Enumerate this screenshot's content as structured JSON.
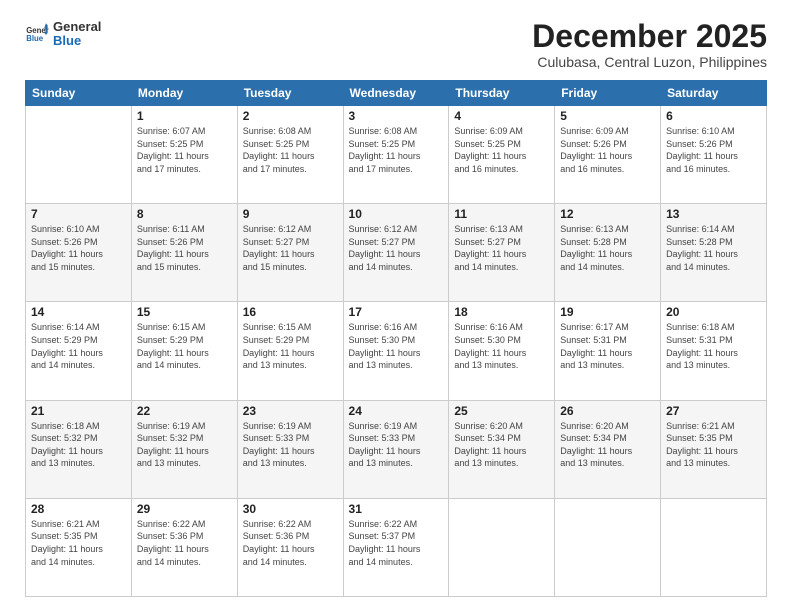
{
  "header": {
    "logo_general": "General",
    "logo_blue": "Blue",
    "month_title": "December 2025",
    "location": "Culubasa, Central Luzon, Philippines"
  },
  "days_of_week": [
    "Sunday",
    "Monday",
    "Tuesday",
    "Wednesday",
    "Thursday",
    "Friday",
    "Saturday"
  ],
  "weeks": [
    [
      {
        "day": "",
        "sunrise": "",
        "sunset": "",
        "daylight": ""
      },
      {
        "day": "1",
        "sunrise": "6:07 AM",
        "sunset": "5:25 PM",
        "daylight": "11 hours and 17 minutes."
      },
      {
        "day": "2",
        "sunrise": "6:08 AM",
        "sunset": "5:25 PM",
        "daylight": "11 hours and 17 minutes."
      },
      {
        "day": "3",
        "sunrise": "6:08 AM",
        "sunset": "5:25 PM",
        "daylight": "11 hours and 17 minutes."
      },
      {
        "day": "4",
        "sunrise": "6:09 AM",
        "sunset": "5:25 PM",
        "daylight": "11 hours and 16 minutes."
      },
      {
        "day": "5",
        "sunrise": "6:09 AM",
        "sunset": "5:26 PM",
        "daylight": "11 hours and 16 minutes."
      },
      {
        "day": "6",
        "sunrise": "6:10 AM",
        "sunset": "5:26 PM",
        "daylight": "11 hours and 16 minutes."
      }
    ],
    [
      {
        "day": "7",
        "sunrise": "6:10 AM",
        "sunset": "5:26 PM",
        "daylight": "11 hours and 15 minutes."
      },
      {
        "day": "8",
        "sunrise": "6:11 AM",
        "sunset": "5:26 PM",
        "daylight": "11 hours and 15 minutes."
      },
      {
        "day": "9",
        "sunrise": "6:12 AM",
        "sunset": "5:27 PM",
        "daylight": "11 hours and 15 minutes."
      },
      {
        "day": "10",
        "sunrise": "6:12 AM",
        "sunset": "5:27 PM",
        "daylight": "11 hours and 14 minutes."
      },
      {
        "day": "11",
        "sunrise": "6:13 AM",
        "sunset": "5:27 PM",
        "daylight": "11 hours and 14 minutes."
      },
      {
        "day": "12",
        "sunrise": "6:13 AM",
        "sunset": "5:28 PM",
        "daylight": "11 hours and 14 minutes."
      },
      {
        "day": "13",
        "sunrise": "6:14 AM",
        "sunset": "5:28 PM",
        "daylight": "11 hours and 14 minutes."
      }
    ],
    [
      {
        "day": "14",
        "sunrise": "6:14 AM",
        "sunset": "5:29 PM",
        "daylight": "11 hours and 14 minutes."
      },
      {
        "day": "15",
        "sunrise": "6:15 AM",
        "sunset": "5:29 PM",
        "daylight": "11 hours and 14 minutes."
      },
      {
        "day": "16",
        "sunrise": "6:15 AM",
        "sunset": "5:29 PM",
        "daylight": "11 hours and 13 minutes."
      },
      {
        "day": "17",
        "sunrise": "6:16 AM",
        "sunset": "5:30 PM",
        "daylight": "11 hours and 13 minutes."
      },
      {
        "day": "18",
        "sunrise": "6:16 AM",
        "sunset": "5:30 PM",
        "daylight": "11 hours and 13 minutes."
      },
      {
        "day": "19",
        "sunrise": "6:17 AM",
        "sunset": "5:31 PM",
        "daylight": "11 hours and 13 minutes."
      },
      {
        "day": "20",
        "sunrise": "6:18 AM",
        "sunset": "5:31 PM",
        "daylight": "11 hours and 13 minutes."
      }
    ],
    [
      {
        "day": "21",
        "sunrise": "6:18 AM",
        "sunset": "5:32 PM",
        "daylight": "11 hours and 13 minutes."
      },
      {
        "day": "22",
        "sunrise": "6:19 AM",
        "sunset": "5:32 PM",
        "daylight": "11 hours and 13 minutes."
      },
      {
        "day": "23",
        "sunrise": "6:19 AM",
        "sunset": "5:33 PM",
        "daylight": "11 hours and 13 minutes."
      },
      {
        "day": "24",
        "sunrise": "6:19 AM",
        "sunset": "5:33 PM",
        "daylight": "11 hours and 13 minutes."
      },
      {
        "day": "25",
        "sunrise": "6:20 AM",
        "sunset": "5:34 PM",
        "daylight": "11 hours and 13 minutes."
      },
      {
        "day": "26",
        "sunrise": "6:20 AM",
        "sunset": "5:34 PM",
        "daylight": "11 hours and 13 minutes."
      },
      {
        "day": "27",
        "sunrise": "6:21 AM",
        "sunset": "5:35 PM",
        "daylight": "11 hours and 13 minutes."
      }
    ],
    [
      {
        "day": "28",
        "sunrise": "6:21 AM",
        "sunset": "5:35 PM",
        "daylight": "11 hours and 14 minutes."
      },
      {
        "day": "29",
        "sunrise": "6:22 AM",
        "sunset": "5:36 PM",
        "daylight": "11 hours and 14 minutes."
      },
      {
        "day": "30",
        "sunrise": "6:22 AM",
        "sunset": "5:36 PM",
        "daylight": "11 hours and 14 minutes."
      },
      {
        "day": "31",
        "sunrise": "6:22 AM",
        "sunset": "5:37 PM",
        "daylight": "11 hours and 14 minutes."
      },
      {
        "day": "",
        "sunrise": "",
        "sunset": "",
        "daylight": ""
      },
      {
        "day": "",
        "sunrise": "",
        "sunset": "",
        "daylight": ""
      },
      {
        "day": "",
        "sunrise": "",
        "sunset": "",
        "daylight": ""
      }
    ]
  ],
  "labels": {
    "sunrise_prefix": "Sunrise: ",
    "sunset_prefix": "Sunset: ",
    "daylight_prefix": "Daylight: "
  }
}
